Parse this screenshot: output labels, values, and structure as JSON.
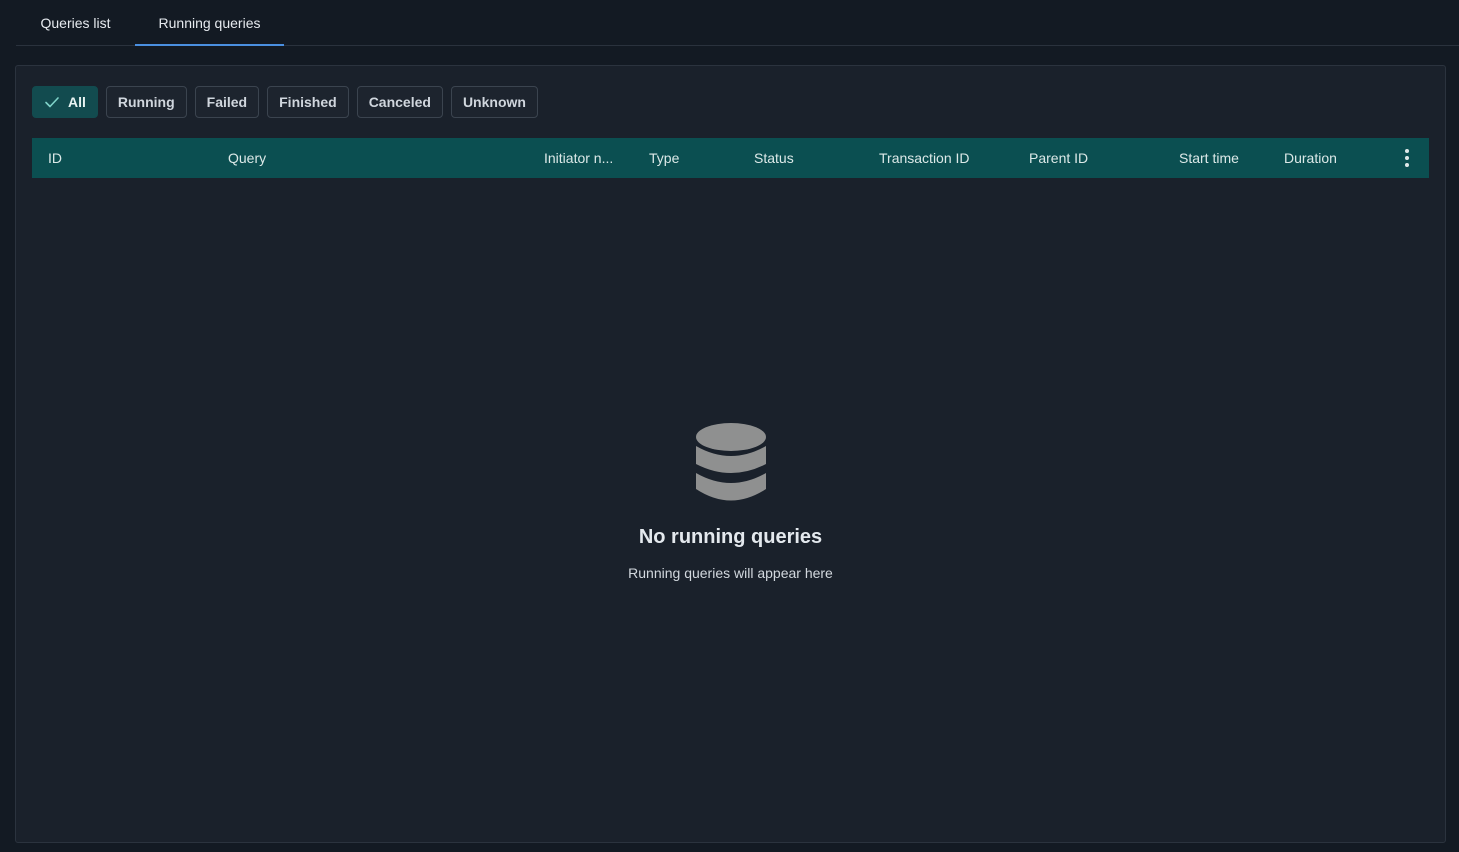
{
  "tabs": [
    {
      "label": "Queries list",
      "active": false
    },
    {
      "label": "Running queries",
      "active": true
    }
  ],
  "filters": [
    {
      "label": "All",
      "selected": true
    },
    {
      "label": "Running",
      "selected": false
    },
    {
      "label": "Failed",
      "selected": false
    },
    {
      "label": "Finished",
      "selected": false
    },
    {
      "label": "Canceled",
      "selected": false
    },
    {
      "label": "Unknown",
      "selected": false
    }
  ],
  "table": {
    "columns": [
      "ID",
      "Query",
      "Initiator n...",
      "Type",
      "Status",
      "Transaction ID",
      "Parent ID",
      "Start time",
      "Duration"
    ],
    "header_color": "#0b4f51"
  },
  "empty_state": {
    "icon": "database-icon",
    "title": "No running queries",
    "subtitle": "Running queries will appear here"
  },
  "colors": {
    "background": "#131a23",
    "panel": "#1a212b",
    "accent": "#4a8fe0",
    "selected_chip": "#124b4f"
  }
}
